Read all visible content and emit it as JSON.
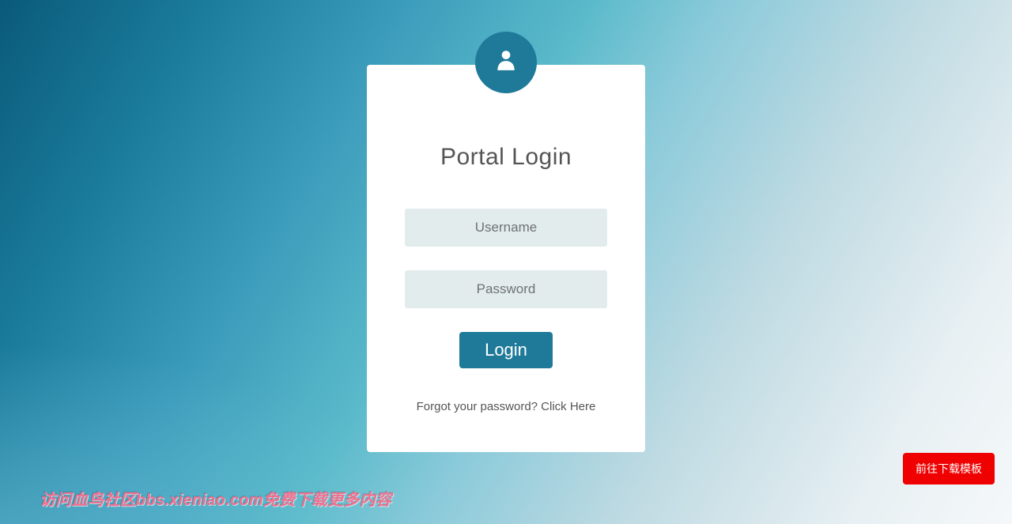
{
  "card": {
    "title": "Portal Login",
    "username_placeholder": "Username",
    "password_placeholder": "Password",
    "login_button_label": "Login",
    "forgot_text": "Forgot your password? Click Here",
    "icon_name": "user-icon"
  },
  "floating": {
    "download_label": "前往下载模板",
    "watermark_text": "访问血鸟社区bbs.xieniao.com免费下载更多内容"
  },
  "colors": {
    "accent": "#1f7a99",
    "input_bg": "#e3eced",
    "danger": "#ef0101"
  }
}
